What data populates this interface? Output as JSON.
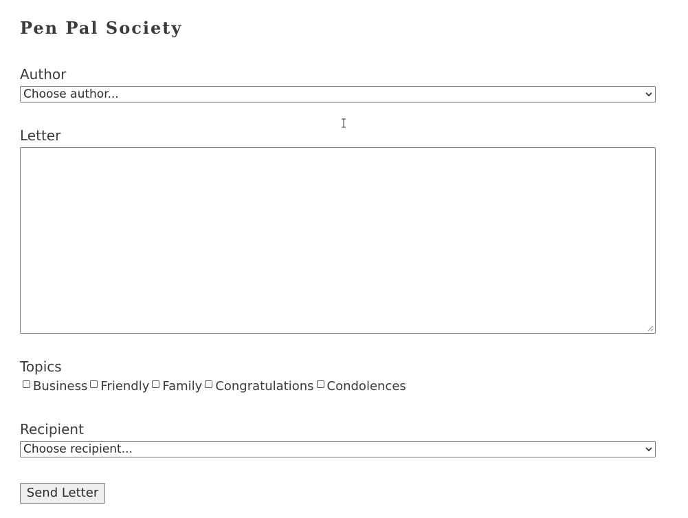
{
  "header": {
    "title": "Pen Pal Society"
  },
  "form": {
    "author": {
      "label": "Author",
      "selected": "Choose author..."
    },
    "letter": {
      "label": "Letter",
      "value": ""
    },
    "topics": {
      "label": "Topics",
      "options": [
        {
          "label": "Business",
          "checked": false
        },
        {
          "label": "Friendly",
          "checked": false
        },
        {
          "label": "Family",
          "checked": false
        },
        {
          "label": "Congratulations",
          "checked": false
        },
        {
          "label": "Condolences",
          "checked": false
        }
      ]
    },
    "recipient": {
      "label": "Recipient",
      "selected": "Choose recipient..."
    },
    "submit_label": "Send Letter"
  },
  "icons": {
    "dropdown": "chevron-down-icon",
    "cursor": "text-cursor-icon",
    "resize": "resize-grip-icon"
  }
}
